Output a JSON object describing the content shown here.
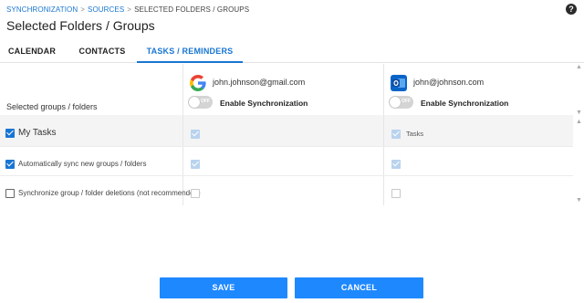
{
  "breadcrumb": {
    "items": [
      "SYNCHRONIZATION",
      "SOURCES",
      "SELECTED FOLDERS / GROUPS"
    ],
    "separator": ">"
  },
  "help_icon": "?",
  "page_title": "Selected Folders / Groups",
  "tabs": [
    {
      "label": "CALENDAR",
      "active": false
    },
    {
      "label": "CONTACTS",
      "active": false
    },
    {
      "label": "TASKS / REMINDERS",
      "active": true
    }
  ],
  "table": {
    "header_label": "Selected groups / folders",
    "accounts": [
      {
        "email": "john.johnson@gmail.com",
        "icon": "google-icon",
        "toggle_text": "OFF",
        "enable_label": "Enable Synchronization"
      },
      {
        "email": "john@johnson.com",
        "icon": "outlook-icon",
        "toggle_text": "OFF",
        "enable_label": "Enable Synchronization"
      }
    ],
    "rows": [
      {
        "label": "My Tasks",
        "checked": true,
        "col1_checked": true,
        "col2_checked": true,
        "col2_text": "Tasks"
      },
      {
        "label": "Automatically sync new groups / folders",
        "checked": true,
        "col1_checked": true,
        "col2_checked": true
      },
      {
        "label": "Synchronize group / folder deletions (not recommended)",
        "checked": false,
        "col1_checked": false,
        "col2_checked": false
      }
    ]
  },
  "buttons": {
    "save": "SAVE",
    "cancel": "CANCEL"
  },
  "colors": {
    "accent": "#1976d2",
    "button": "#1e88ff"
  }
}
